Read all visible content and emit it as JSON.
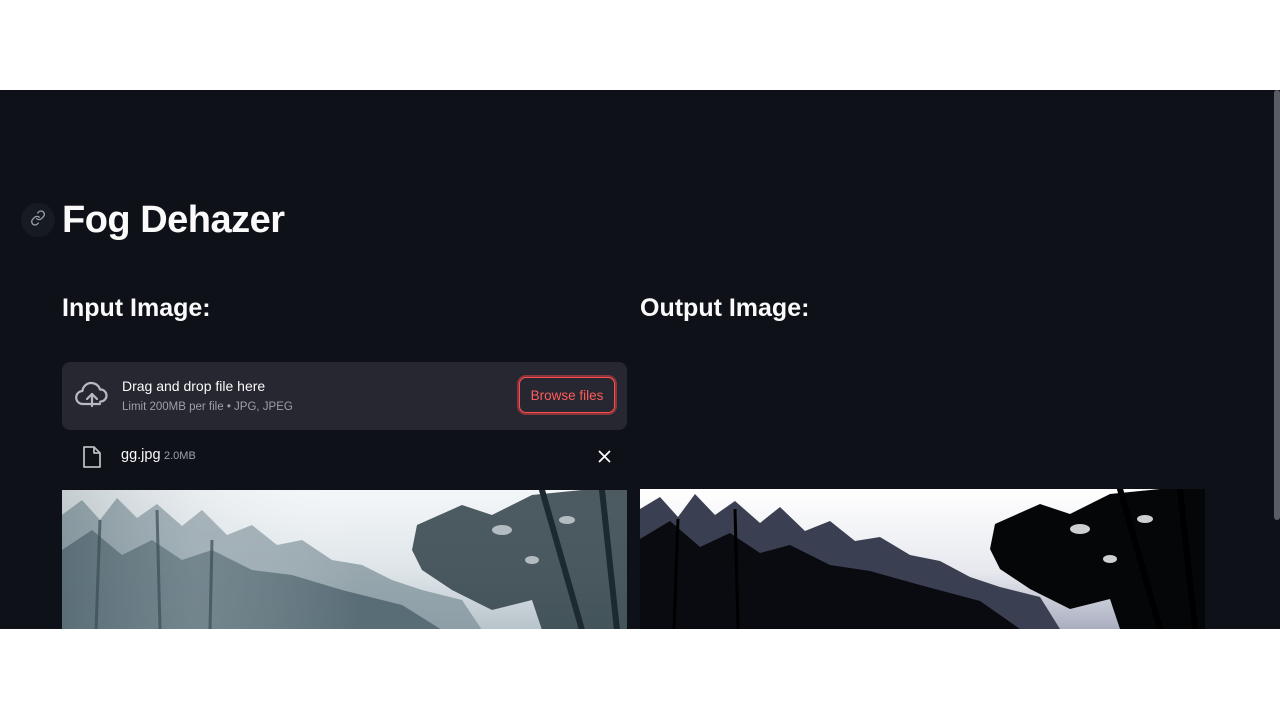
{
  "app": {
    "title": "Fog Dehazer"
  },
  "sections": {
    "input_heading": "Input Image:",
    "output_heading": "Output Image:"
  },
  "uploader": {
    "drop_text": "Drag and drop file here",
    "limit_text": "Limit 200MB per file • JPG, JPEG",
    "browse_label": "Browse files",
    "accent_color": "#ff4b4b"
  },
  "file": {
    "name": "gg.jpg",
    "size": "2.0MB"
  },
  "icons": {
    "anchor": "link-icon",
    "upload": "cloud-upload-icon",
    "file": "file-icon",
    "remove": "close-icon"
  },
  "images": {
    "input": "foggy forest photo (hazy)",
    "output": "dehazed forest photo (high contrast)"
  }
}
